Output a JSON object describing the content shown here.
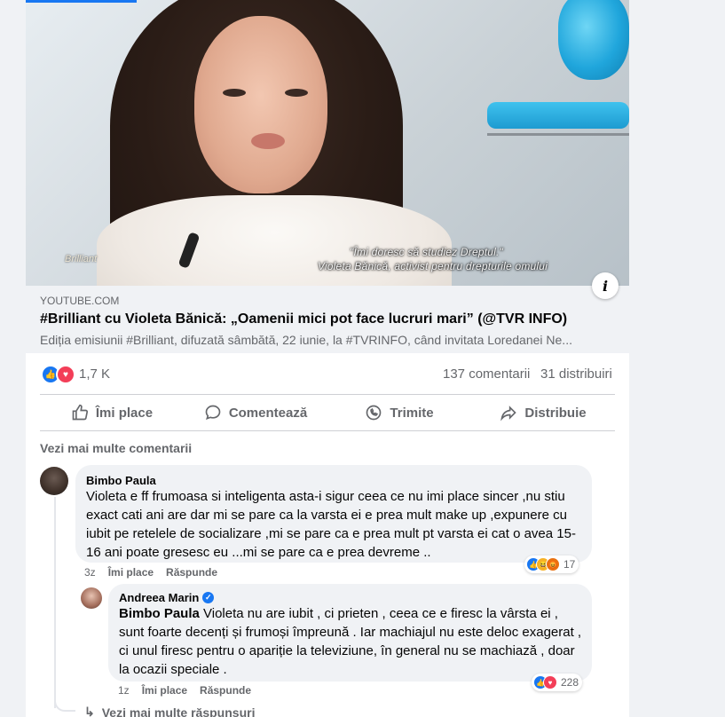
{
  "post": {
    "media": {
      "subtitle_line1": "\"Îmi doresc să studiez Dreptul.\"",
      "subtitle_line2": "Violeta Bănică, activist pentru drepturile omului",
      "watermark": "Brilliant"
    },
    "link_preview": {
      "domain": "YOUTUBE.COM",
      "title": "#Brilliant cu Violeta Bănică: „Oamenii mici pot face lucruri mari” (@TVR INFO)",
      "description": "Ediția emisiunii #Brilliant, difuzată sâmbătă, 22 iunie, la #TVRINFO, când invitata Loredanei Ne..."
    },
    "stats": {
      "reactions": "1,7 K",
      "comments": "137 comentarii",
      "shares": "31 distribuiri"
    },
    "actions": {
      "like": "Îmi place",
      "comment": "Comentează",
      "send": "Trimite",
      "share": "Distribuie"
    },
    "more_comments": "Vezi mai multe comentarii"
  },
  "comments": [
    {
      "author": "Bimbo Paula",
      "text": "Violeta e ff frumoasa si inteligenta asta-i sigur ceea ce nu imi place sincer ,nu stiu exact cati ani are dar mi se pare ca la varsta ei e prea mult make up ,expunere cu iubit pe retelele de socializare ,mi se pare ca e prea mult pt varsta ei cat o avea 15-16 ani poate gresesc eu ...mi se pare ca e prea devreme ..",
      "time": "3z",
      "like_label": "Îmi place",
      "reply_label": "Răspunde",
      "reaction_count": "17"
    },
    {
      "author": "Andreea Marin",
      "mention": "Bimbo Paula",
      "text": " Violeta nu are iubit , ci prieten , ceea ce e firesc la vârsta ei , sunt foarte decenți și frumoși împreună . Iar machiajul nu este deloc exagerat , ci unul firesc pentru o apariție la televiziune, în general nu se machiază , doar la ocazii speciale .",
      "time": "1z",
      "like_label": "Îmi place",
      "reply_label": "Răspunde",
      "reaction_count": "228"
    }
  ],
  "more_replies": "Vezi mai multe răspunsuri",
  "colors": {
    "accent": "#1877f2",
    "love": "#f33e58",
    "text_secondary": "#65676b",
    "bubble": "#f0f2f5"
  }
}
